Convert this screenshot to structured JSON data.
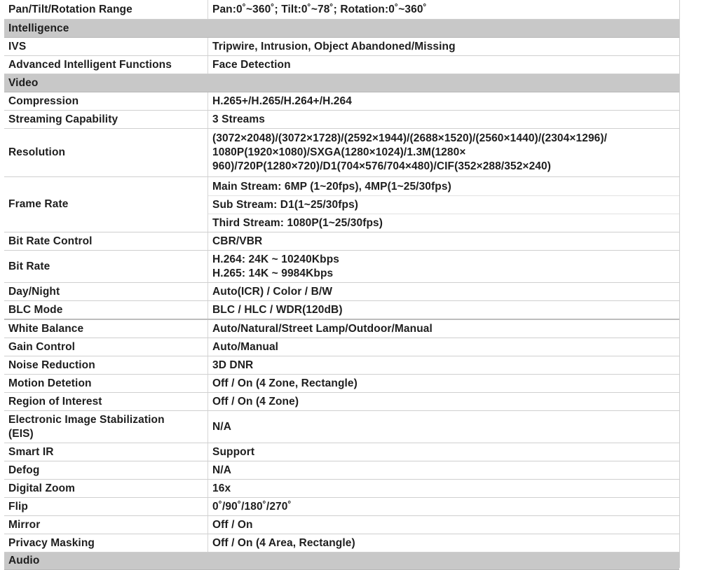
{
  "rows": {
    "pan_tilt": {
      "label": "Pan/Tilt/Rotation Range",
      "value": "Pan:0˚~360˚; Tilt:0˚~78˚; Rotation:0˚~360˚"
    },
    "sec_intelligence": "Intelligence",
    "ivs": {
      "label": "IVS",
      "value": "Tripwire, Intrusion, Object Abandoned/Missing"
    },
    "advanced": {
      "label": "Advanced Intelligent Functions",
      "value": "Face Detection"
    },
    "sec_video": "Video",
    "compression": {
      "label": "Compression",
      "value": "H.265+/H.265/H.264+/H.264"
    },
    "streaming": {
      "label": "Streaming Capability",
      "value": "3 Streams"
    },
    "resolution": {
      "label": "Resolution",
      "lines": [
        "(3072×2048)/(3072×1728)/(2592×1944)/(2688×1520)/(2560×1440)/(2304×1296)/",
        "1080P(1920×1080)/SXGA(1280×1024)/1.3M(1280×",
        "960)/720P(1280×720)/D1(704×576/704×480)/CIF(352×288/352×240)"
      ]
    },
    "frame_rate": {
      "label": "Frame Rate",
      "lines": [
        "Main Stream: 6MP (1~20fps), 4MP(1~25/30fps)",
        "Sub Stream: D1(1~25/30fps)",
        "Third Stream: 1080P(1~25/30fps)"
      ]
    },
    "bitrate_control": {
      "label": "Bit Rate Control",
      "value": "CBR/VBR"
    },
    "bitrate": {
      "label": "Bit Rate",
      "lines": [
        "H.264: 24K ~ 10240Kbps",
        "H.265: 14K ~ 9984Kbps"
      ]
    },
    "day_night": {
      "label": "Day/Night",
      "value": "Auto(ICR) / Color / B/W"
    },
    "blc": {
      "label": "BLC Mode",
      "value": "BLC / HLC / WDR(120dB)"
    },
    "white_balance": {
      "label": "White Balance",
      "value": "Auto/Natural/Street Lamp/Outdoor/Manual"
    },
    "gain": {
      "label": "Gain Control",
      "value": "Auto/Manual"
    },
    "noise": {
      "label": "Noise Reduction",
      "value": "3D DNR"
    },
    "motion": {
      "label": "Motion Detetion",
      "value": "Off / On (4 Zone, Rectangle)"
    },
    "roi": {
      "label": "Region of Interest",
      "value": "Off / On (4 Zone)"
    },
    "eis": {
      "label_lines": [
        "Electronic Image Stabilization",
        "(EIS)"
      ],
      "value": "N/A"
    },
    "smart_ir": {
      "label": "Smart IR",
      "value": "Support"
    },
    "defog": {
      "label": "Defog",
      "value": "N/A"
    },
    "zoom": {
      "label": "Digital Zoom",
      "value": "16x"
    },
    "flip": {
      "label": "Flip",
      "value": "0˚/90˚/180˚/270˚"
    },
    "mirror": {
      "label": "Mirror",
      "value": "Off / On"
    },
    "privacy": {
      "label": "Privacy Masking",
      "value": "Off / On (4 Area, Rectangle)"
    },
    "sec_audio": "Audio"
  },
  "colors": {
    "section_bg": "#c8c8c8",
    "text": "#1e1e1e",
    "border": "#cfcfcf"
  }
}
